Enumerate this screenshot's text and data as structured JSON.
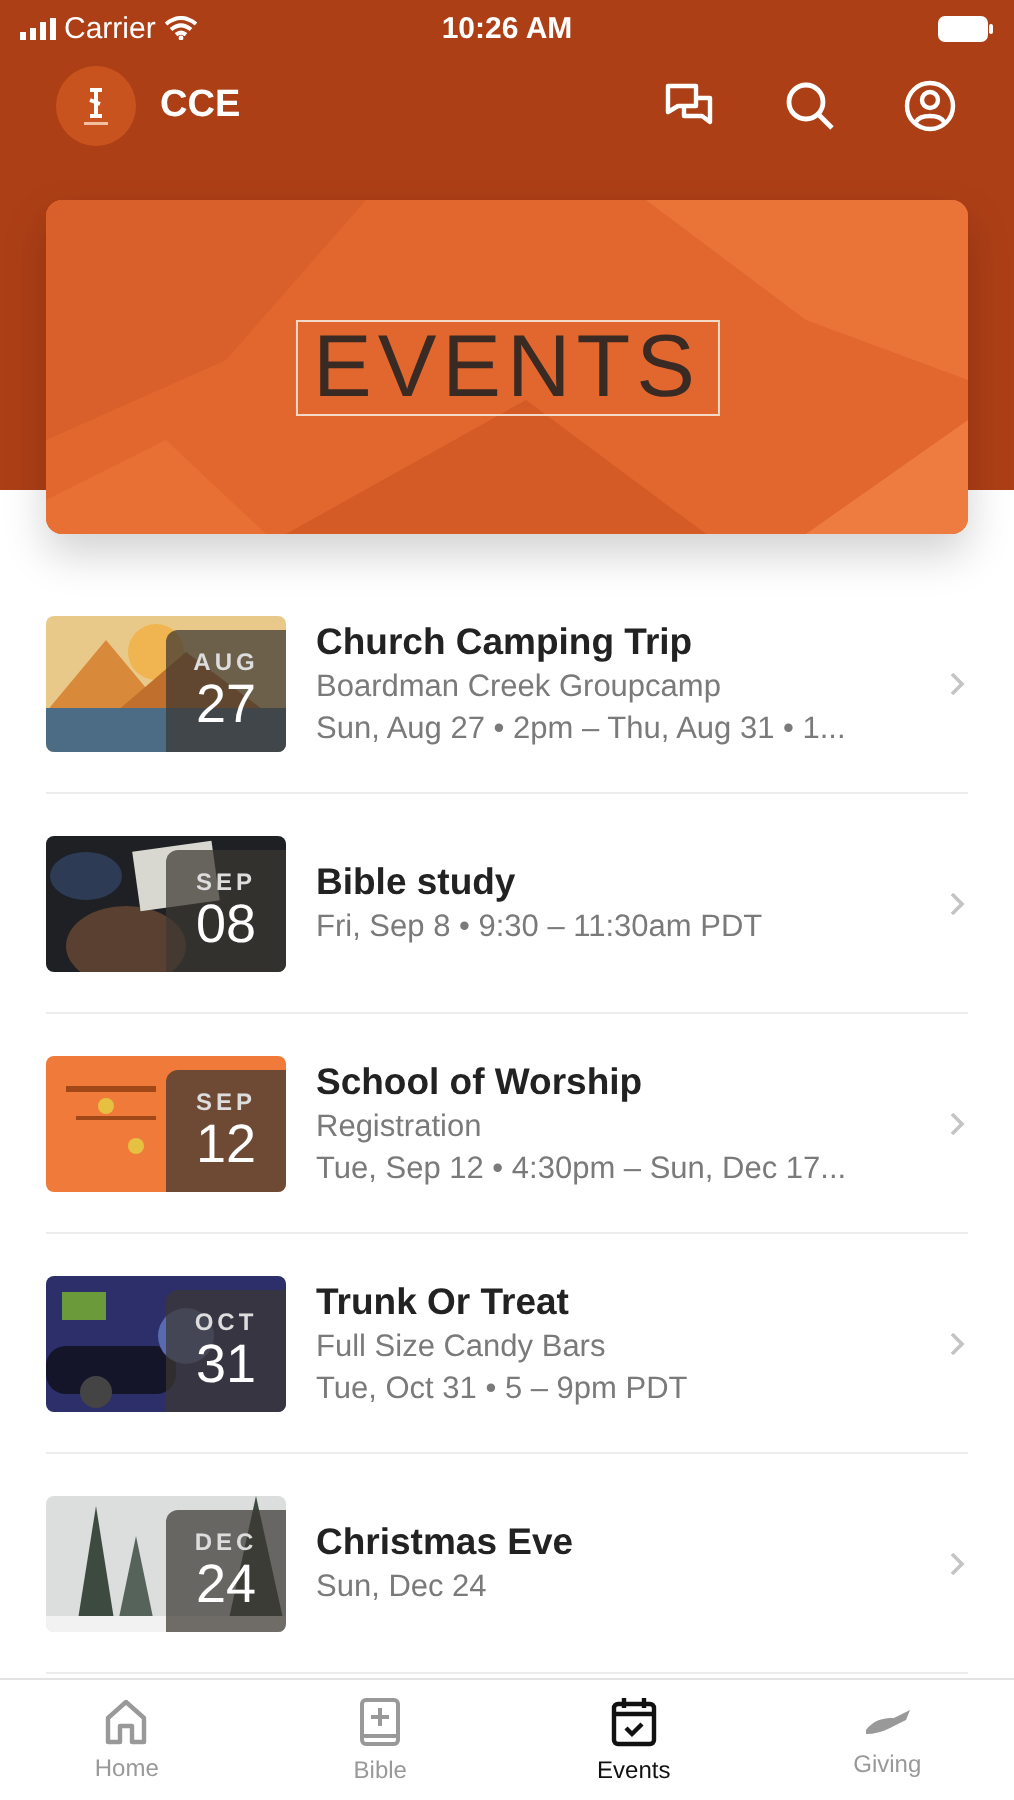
{
  "status_bar": {
    "carrier": "Carrier",
    "time": "10:26 AM"
  },
  "header": {
    "title": "CCE"
  },
  "banner": {
    "title": "EVENTS"
  },
  "events": [
    {
      "month": "AUG",
      "day": "27",
      "title": "Church Camping Trip",
      "lines": [
        "Boardman Creek Groupcamp",
        "Sun, Aug 27 • 2pm – Thu, Aug 31 • 1..."
      ]
    },
    {
      "month": "SEP",
      "day": "08",
      "title": "Bible study",
      "lines": [
        "Fri, Sep 8 • 9:30 – 11:30am PDT"
      ]
    },
    {
      "month": "SEP",
      "day": "12",
      "title": "School of Worship",
      "lines": [
        "Registration",
        "Tue, Sep 12 • 4:30pm – Sun, Dec 17..."
      ]
    },
    {
      "month": "OCT",
      "day": "31",
      "title": "Trunk Or Treat",
      "lines": [
        "Full Size Candy Bars",
        "Tue, Oct 31 • 5 – 9pm PDT"
      ]
    },
    {
      "month": "DEC",
      "day": "24",
      "title": "Christmas Eve",
      "lines": [
        "Sun, Dec 24"
      ]
    }
  ],
  "tabs": [
    {
      "kind": "home",
      "label": "Home",
      "selected": false
    },
    {
      "kind": "bible",
      "label": "Bible",
      "selected": false
    },
    {
      "kind": "events",
      "label": "Events",
      "selected": true
    },
    {
      "kind": "giving",
      "label": "Giving",
      "selected": false
    }
  ]
}
